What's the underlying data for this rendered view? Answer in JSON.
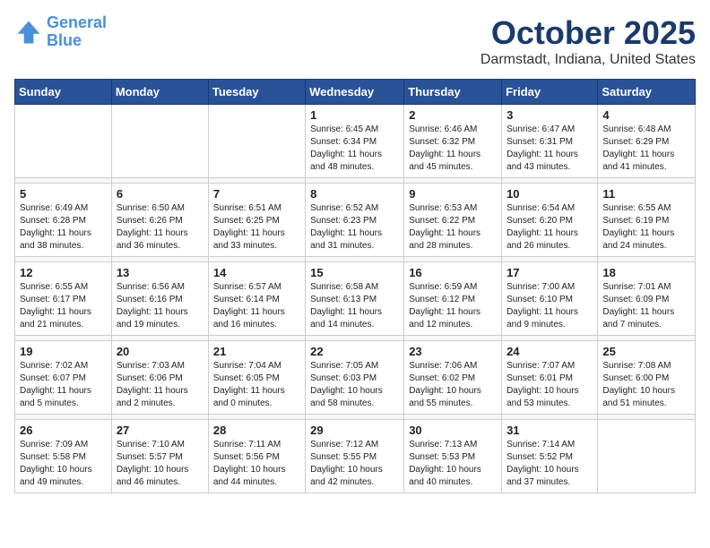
{
  "header": {
    "logo_line1": "General",
    "logo_line2": "Blue",
    "month": "October 2025",
    "location": "Darmstadt, Indiana, United States"
  },
  "weekdays": [
    "Sunday",
    "Monday",
    "Tuesday",
    "Wednesday",
    "Thursday",
    "Friday",
    "Saturday"
  ],
  "weeks": [
    [
      {
        "day": "",
        "info": ""
      },
      {
        "day": "",
        "info": ""
      },
      {
        "day": "",
        "info": ""
      },
      {
        "day": "1",
        "info": "Sunrise: 6:45 AM\nSunset: 6:34 PM\nDaylight: 11 hours\nand 48 minutes."
      },
      {
        "day": "2",
        "info": "Sunrise: 6:46 AM\nSunset: 6:32 PM\nDaylight: 11 hours\nand 45 minutes."
      },
      {
        "day": "3",
        "info": "Sunrise: 6:47 AM\nSunset: 6:31 PM\nDaylight: 11 hours\nand 43 minutes."
      },
      {
        "day": "4",
        "info": "Sunrise: 6:48 AM\nSunset: 6:29 PM\nDaylight: 11 hours\nand 41 minutes."
      }
    ],
    [
      {
        "day": "5",
        "info": "Sunrise: 6:49 AM\nSunset: 6:28 PM\nDaylight: 11 hours\nand 38 minutes."
      },
      {
        "day": "6",
        "info": "Sunrise: 6:50 AM\nSunset: 6:26 PM\nDaylight: 11 hours\nand 36 minutes."
      },
      {
        "day": "7",
        "info": "Sunrise: 6:51 AM\nSunset: 6:25 PM\nDaylight: 11 hours\nand 33 minutes."
      },
      {
        "day": "8",
        "info": "Sunrise: 6:52 AM\nSunset: 6:23 PM\nDaylight: 11 hours\nand 31 minutes."
      },
      {
        "day": "9",
        "info": "Sunrise: 6:53 AM\nSunset: 6:22 PM\nDaylight: 11 hours\nand 28 minutes."
      },
      {
        "day": "10",
        "info": "Sunrise: 6:54 AM\nSunset: 6:20 PM\nDaylight: 11 hours\nand 26 minutes."
      },
      {
        "day": "11",
        "info": "Sunrise: 6:55 AM\nSunset: 6:19 PM\nDaylight: 11 hours\nand 24 minutes."
      }
    ],
    [
      {
        "day": "12",
        "info": "Sunrise: 6:55 AM\nSunset: 6:17 PM\nDaylight: 11 hours\nand 21 minutes."
      },
      {
        "day": "13",
        "info": "Sunrise: 6:56 AM\nSunset: 6:16 PM\nDaylight: 11 hours\nand 19 minutes."
      },
      {
        "day": "14",
        "info": "Sunrise: 6:57 AM\nSunset: 6:14 PM\nDaylight: 11 hours\nand 16 minutes."
      },
      {
        "day": "15",
        "info": "Sunrise: 6:58 AM\nSunset: 6:13 PM\nDaylight: 11 hours\nand 14 minutes."
      },
      {
        "day": "16",
        "info": "Sunrise: 6:59 AM\nSunset: 6:12 PM\nDaylight: 11 hours\nand 12 minutes."
      },
      {
        "day": "17",
        "info": "Sunrise: 7:00 AM\nSunset: 6:10 PM\nDaylight: 11 hours\nand 9 minutes."
      },
      {
        "day": "18",
        "info": "Sunrise: 7:01 AM\nSunset: 6:09 PM\nDaylight: 11 hours\nand 7 minutes."
      }
    ],
    [
      {
        "day": "19",
        "info": "Sunrise: 7:02 AM\nSunset: 6:07 PM\nDaylight: 11 hours\nand 5 minutes."
      },
      {
        "day": "20",
        "info": "Sunrise: 7:03 AM\nSunset: 6:06 PM\nDaylight: 11 hours\nand 2 minutes."
      },
      {
        "day": "21",
        "info": "Sunrise: 7:04 AM\nSunset: 6:05 PM\nDaylight: 11 hours\nand 0 minutes."
      },
      {
        "day": "22",
        "info": "Sunrise: 7:05 AM\nSunset: 6:03 PM\nDaylight: 10 hours\nand 58 minutes."
      },
      {
        "day": "23",
        "info": "Sunrise: 7:06 AM\nSunset: 6:02 PM\nDaylight: 10 hours\nand 55 minutes."
      },
      {
        "day": "24",
        "info": "Sunrise: 7:07 AM\nSunset: 6:01 PM\nDaylight: 10 hours\nand 53 minutes."
      },
      {
        "day": "25",
        "info": "Sunrise: 7:08 AM\nSunset: 6:00 PM\nDaylight: 10 hours\nand 51 minutes."
      }
    ],
    [
      {
        "day": "26",
        "info": "Sunrise: 7:09 AM\nSunset: 5:58 PM\nDaylight: 10 hours\nand 49 minutes."
      },
      {
        "day": "27",
        "info": "Sunrise: 7:10 AM\nSunset: 5:57 PM\nDaylight: 10 hours\nand 46 minutes."
      },
      {
        "day": "28",
        "info": "Sunrise: 7:11 AM\nSunset: 5:56 PM\nDaylight: 10 hours\nand 44 minutes."
      },
      {
        "day": "29",
        "info": "Sunrise: 7:12 AM\nSunset: 5:55 PM\nDaylight: 10 hours\nand 42 minutes."
      },
      {
        "day": "30",
        "info": "Sunrise: 7:13 AM\nSunset: 5:53 PM\nDaylight: 10 hours\nand 40 minutes."
      },
      {
        "day": "31",
        "info": "Sunrise: 7:14 AM\nSunset: 5:52 PM\nDaylight: 10 hours\nand 37 minutes."
      },
      {
        "day": "",
        "info": ""
      }
    ]
  ]
}
